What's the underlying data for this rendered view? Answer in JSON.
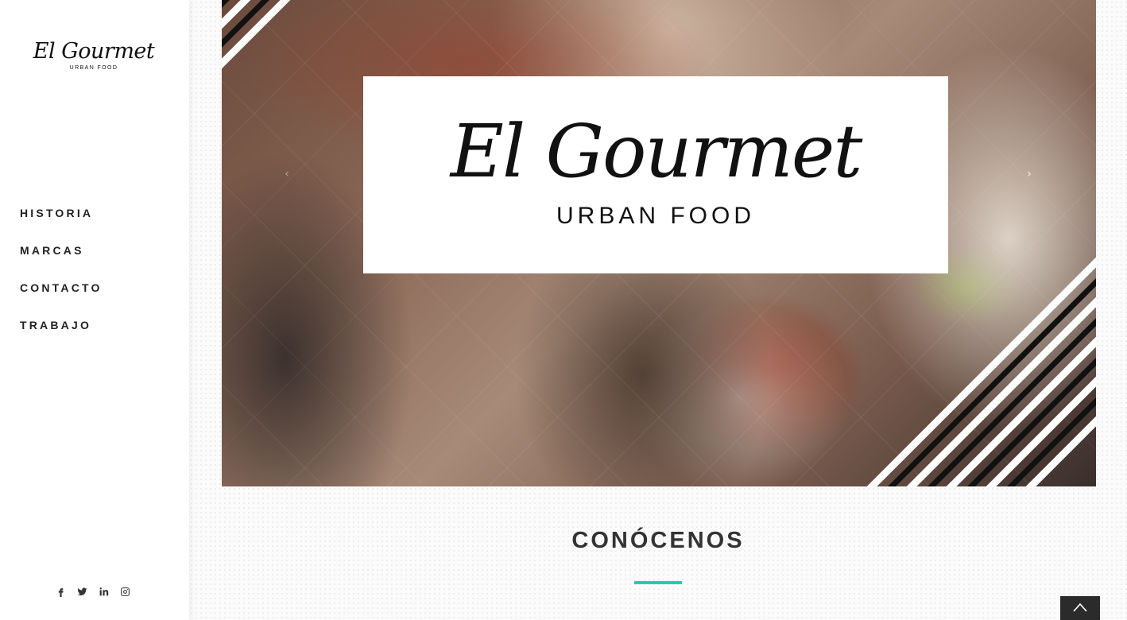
{
  "sidebar": {
    "logo": {
      "script": "El Gourmet",
      "tagline": "URBAN FOOD"
    },
    "nav": [
      {
        "label": "HISTORIA"
      },
      {
        "label": "MARCAS"
      },
      {
        "label": "CONTACTO"
      },
      {
        "label": "TRABAJO"
      }
    ],
    "social": [
      "facebook-icon",
      "twitter-icon",
      "linkedin-icon",
      "instagram-icon"
    ]
  },
  "hero": {
    "logo_script": "El Gourmet",
    "logo_tagline": "URBAN FOOD",
    "prev_arrow": "‹",
    "next_arrow": "›"
  },
  "section": {
    "title": "CONÓCENOS",
    "accent_color": "#1ecfb2"
  },
  "back_to_top": {
    "icon": "chevron-up-icon"
  }
}
